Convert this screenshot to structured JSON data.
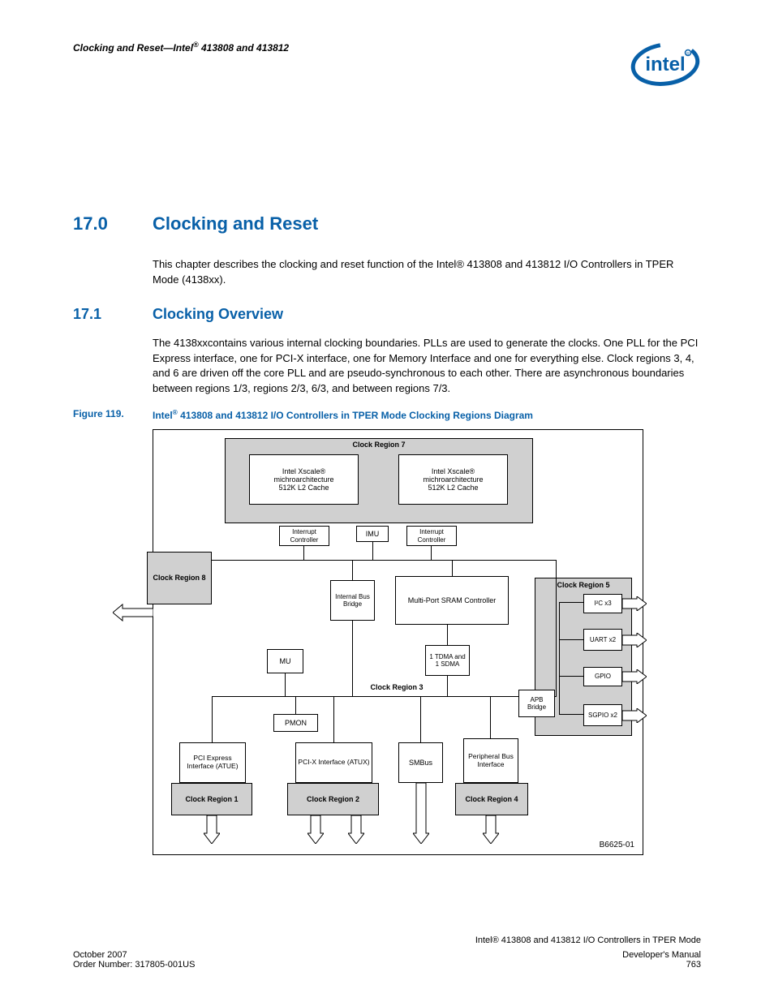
{
  "header": {
    "section": "Clocking and Reset—Intel",
    "products": " 413808 and 413812"
  },
  "h1": {
    "num": "17.0",
    "title": "Clocking and Reset"
  },
  "intro": "This chapter describes the clocking and reset function of the Intel® 413808 and 413812 I/O Controllers in TPER Mode (4138xx).",
  "h2": {
    "num": "17.1",
    "title": "Clocking Overview"
  },
  "para17_1": "The 4138xxcontains various internal clocking boundaries. PLLs are used to generate the clocks. One PLL for the PCI Express interface, one for PCI-X interface, one for Memory Interface and one for everything else. Clock regions 3, 4, and 6 are driven off the core PLL and are pseudo-synchronous to each other. There are asynchronous boundaries between regions 1/3, regions 2/3, 6/3, and between regions 7/3.",
  "figure": {
    "label": "Figure 119.",
    "caption_prefix": "Intel",
    "caption_rest": " 413808 and 413812 I/O Controllers in TPER Mode Clocking Regions Diagram",
    "ref": "B6625-01"
  },
  "blocks": {
    "region7": "Clock Region 7",
    "xscale1a": "Intel Xscale®",
    "xscale1b": "michroarchitecture",
    "xscale1c": "512K L2 Cache",
    "intc": "Interrupt Controller",
    "imu": "IMU",
    "region8": "Clock Region 8",
    "ibb": "Internal Bus Bridge",
    "mpsc": "Multi-Port SRAM Controller",
    "region5": "Clock Region 5",
    "i2c": "I²C x3",
    "uart": "UART x2",
    "gpio": "GPIO",
    "sgpio": "SGPIO x2",
    "mu": "MU",
    "tdma": "1 TDMA and 1 SDMA",
    "region3": "Clock Region 3",
    "apb": "APB Bridge",
    "pmon": "PMON",
    "atue": "PCI Express Interface (ATUE)",
    "atux": "PCI-X Interface (ATUX)",
    "smbus": "SMBus",
    "pbi": "Peripheral Bus Interface",
    "region1": "Clock Region 1",
    "region2": "Clock Region 2",
    "region4": "Clock Region 4"
  },
  "footer": {
    "left1": "October 2007",
    "left2": "Order Number: 317805-001US",
    "right1": "Intel® 413808 and 413812 I/O Controllers in TPER Mode",
    "right2": "Developer's Manual",
    "page": "763"
  }
}
